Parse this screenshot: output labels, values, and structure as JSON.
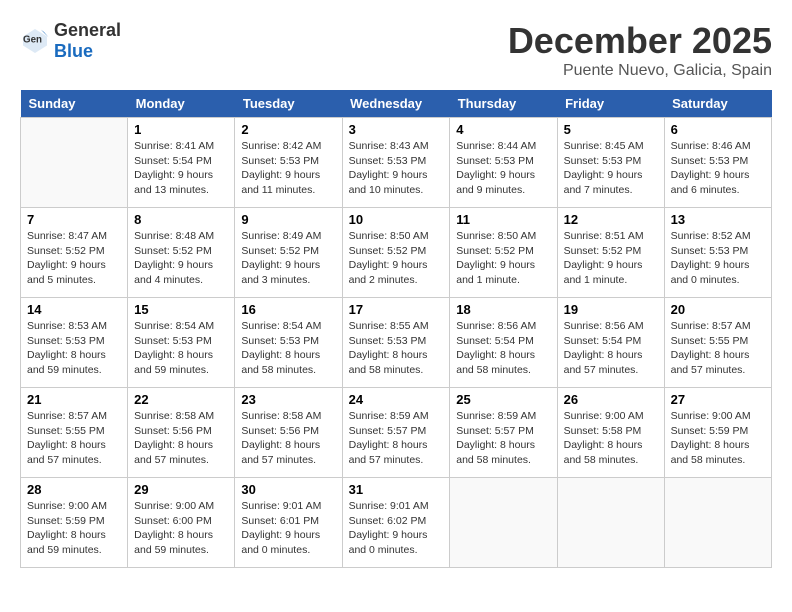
{
  "header": {
    "logo_general": "General",
    "logo_blue": "Blue",
    "month": "December 2025",
    "location": "Puente Nuevo, Galicia, Spain"
  },
  "weekdays": [
    "Sunday",
    "Monday",
    "Tuesday",
    "Wednesday",
    "Thursday",
    "Friday",
    "Saturday"
  ],
  "weeks": [
    [
      {
        "day": "",
        "info": ""
      },
      {
        "day": "1",
        "info": "Sunrise: 8:41 AM\nSunset: 5:54 PM\nDaylight: 9 hours\nand 13 minutes."
      },
      {
        "day": "2",
        "info": "Sunrise: 8:42 AM\nSunset: 5:53 PM\nDaylight: 9 hours\nand 11 minutes."
      },
      {
        "day": "3",
        "info": "Sunrise: 8:43 AM\nSunset: 5:53 PM\nDaylight: 9 hours\nand 10 minutes."
      },
      {
        "day": "4",
        "info": "Sunrise: 8:44 AM\nSunset: 5:53 PM\nDaylight: 9 hours\nand 9 minutes."
      },
      {
        "day": "5",
        "info": "Sunrise: 8:45 AM\nSunset: 5:53 PM\nDaylight: 9 hours\nand 7 minutes."
      },
      {
        "day": "6",
        "info": "Sunrise: 8:46 AM\nSunset: 5:53 PM\nDaylight: 9 hours\nand 6 minutes."
      }
    ],
    [
      {
        "day": "7",
        "info": "Sunrise: 8:47 AM\nSunset: 5:52 PM\nDaylight: 9 hours\nand 5 minutes."
      },
      {
        "day": "8",
        "info": "Sunrise: 8:48 AM\nSunset: 5:52 PM\nDaylight: 9 hours\nand 4 minutes."
      },
      {
        "day": "9",
        "info": "Sunrise: 8:49 AM\nSunset: 5:52 PM\nDaylight: 9 hours\nand 3 minutes."
      },
      {
        "day": "10",
        "info": "Sunrise: 8:50 AM\nSunset: 5:52 PM\nDaylight: 9 hours\nand 2 minutes."
      },
      {
        "day": "11",
        "info": "Sunrise: 8:50 AM\nSunset: 5:52 PM\nDaylight: 9 hours\nand 1 minute."
      },
      {
        "day": "12",
        "info": "Sunrise: 8:51 AM\nSunset: 5:52 PM\nDaylight: 9 hours\nand 1 minute."
      },
      {
        "day": "13",
        "info": "Sunrise: 8:52 AM\nSunset: 5:53 PM\nDaylight: 9 hours\nand 0 minutes."
      }
    ],
    [
      {
        "day": "14",
        "info": "Sunrise: 8:53 AM\nSunset: 5:53 PM\nDaylight: 8 hours\nand 59 minutes."
      },
      {
        "day": "15",
        "info": "Sunrise: 8:54 AM\nSunset: 5:53 PM\nDaylight: 8 hours\nand 59 minutes."
      },
      {
        "day": "16",
        "info": "Sunrise: 8:54 AM\nSunset: 5:53 PM\nDaylight: 8 hours\nand 58 minutes."
      },
      {
        "day": "17",
        "info": "Sunrise: 8:55 AM\nSunset: 5:53 PM\nDaylight: 8 hours\nand 58 minutes."
      },
      {
        "day": "18",
        "info": "Sunrise: 8:56 AM\nSunset: 5:54 PM\nDaylight: 8 hours\nand 58 minutes."
      },
      {
        "day": "19",
        "info": "Sunrise: 8:56 AM\nSunset: 5:54 PM\nDaylight: 8 hours\nand 57 minutes."
      },
      {
        "day": "20",
        "info": "Sunrise: 8:57 AM\nSunset: 5:55 PM\nDaylight: 8 hours\nand 57 minutes."
      }
    ],
    [
      {
        "day": "21",
        "info": "Sunrise: 8:57 AM\nSunset: 5:55 PM\nDaylight: 8 hours\nand 57 minutes."
      },
      {
        "day": "22",
        "info": "Sunrise: 8:58 AM\nSunset: 5:56 PM\nDaylight: 8 hours\nand 57 minutes."
      },
      {
        "day": "23",
        "info": "Sunrise: 8:58 AM\nSunset: 5:56 PM\nDaylight: 8 hours\nand 57 minutes."
      },
      {
        "day": "24",
        "info": "Sunrise: 8:59 AM\nSunset: 5:57 PM\nDaylight: 8 hours\nand 57 minutes."
      },
      {
        "day": "25",
        "info": "Sunrise: 8:59 AM\nSunset: 5:57 PM\nDaylight: 8 hours\nand 58 minutes."
      },
      {
        "day": "26",
        "info": "Sunrise: 9:00 AM\nSunset: 5:58 PM\nDaylight: 8 hours\nand 58 minutes."
      },
      {
        "day": "27",
        "info": "Sunrise: 9:00 AM\nSunset: 5:59 PM\nDaylight: 8 hours\nand 58 minutes."
      }
    ],
    [
      {
        "day": "28",
        "info": "Sunrise: 9:00 AM\nSunset: 5:59 PM\nDaylight: 8 hours\nand 59 minutes."
      },
      {
        "day": "29",
        "info": "Sunrise: 9:00 AM\nSunset: 6:00 PM\nDaylight: 8 hours\nand 59 minutes."
      },
      {
        "day": "30",
        "info": "Sunrise: 9:01 AM\nSunset: 6:01 PM\nDaylight: 9 hours\nand 0 minutes."
      },
      {
        "day": "31",
        "info": "Sunrise: 9:01 AM\nSunset: 6:02 PM\nDaylight: 9 hours\nand 0 minutes."
      },
      {
        "day": "",
        "info": ""
      },
      {
        "day": "",
        "info": ""
      },
      {
        "day": "",
        "info": ""
      }
    ]
  ]
}
